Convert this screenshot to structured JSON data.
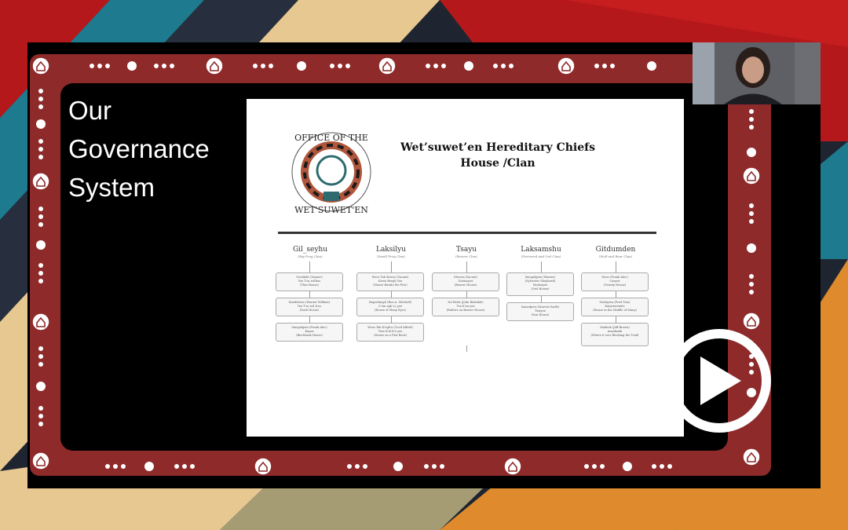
{
  "slide": {
    "title": "Our\nGovernance\nSystem"
  },
  "document": {
    "title": "Wet’suwet’en Hereditary Chiefs\nHouse /Clan",
    "seal_text": "OFFICE OF THE WET'SUWET'EN",
    "clans": [
      {
        "name": "Gil_seyhu",
        "subtitle": "(Big Frog Clan)",
        "houses": [
          "Goohlaht (Yaanee)\nYex T'sa wil'kus\n(Thin House)",
          "Knedebeas (Warner William)\nYex T'sa wil_k'us\n(Dark House)",
          "Smogelgem (Frank Alec)\nKayax\n(Birchbark House)"
        ]
      },
      {
        "name": "Laksilyu",
        "subtitle": "(Small Frog Clan)",
        "houses": [
          "Woos Tah Kewos (Vacant)\nKwen Beegh Yex\n(House Beside the Fire)",
          "Hagwilnegh (Ron A. Mitchell)\nC'ein agh Li_yex\n(House of Many Eyes)",
          "Woos Tah K'egh'a (Cecil Alfred)\nTsee K'al K'e yex\n(House on a Flat Rock)"
        ]
      },
      {
        "name": "Tsayu",
        "subtitle": "(Beaver Clan)",
        "houses": [
          "Dtsewa (Vacant)\nDistiasyex\n(Beaver House)",
          "Na'Moks (John Ridsdale)\nTsa K'en yex\n(Rafters on Beaver House)"
        ]
      },
      {
        "name": "Laksamshu",
        "subtitle": "(Fireweed and Owl Clan)",
        "houses": [
          "Smogelgem (Warner)\n(Sylvester Shepherd)\nMedzeyex\n(Owl House)",
          "Samedjeez (Marvin Nadle)\nTsaiyex\n(Sun House)"
        ]
      },
      {
        "name": "Gitdumden",
        "subtitle": "(Wolf and Bear Clan)",
        "houses": [
          "Woos (Frank Alec)\nCasyex\n(Grizzly House)",
          "Gisdaywa (Fred Tom)\nKaiyexweniits\n(House in the Middle of Many)",
          "Madeek (Jeff Brown)\nAnaskaski\n(Where it Lies Blocking the Trail)"
        ]
      }
    ]
  },
  "colors": {
    "frame_red": "#8e2a2a",
    "stripe_red": "#b5181b",
    "stripe_teal": "#1e7b8f",
    "stripe_cream": "#e8c891",
    "stripe_orange": "#df8a2d",
    "stripe_olive": "#a69c73",
    "stripe_navy": "#272e3d"
  },
  "icons": {
    "play": "play-icon",
    "house": "house-icon"
  }
}
